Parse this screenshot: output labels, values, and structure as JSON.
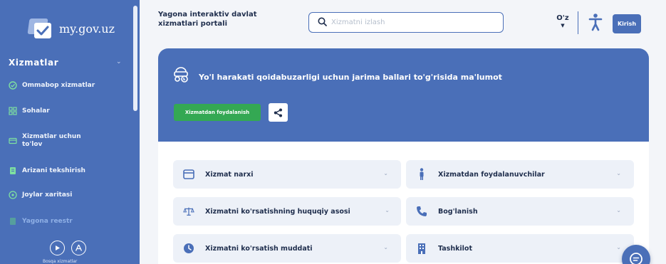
{
  "brand": {
    "logo_text": "my.gov.uz"
  },
  "sidebar": {
    "section_title": "Xizmatlar",
    "items": [
      {
        "label": "Ommabop xizmatlar",
        "icon": "check-circle-icon"
      },
      {
        "label": "Sohalar",
        "icon": "grid-icon"
      },
      {
        "label": "Xizmatlar uchun to'lov",
        "icon": "card-icon"
      },
      {
        "label": "Arizani tekshirish",
        "icon": "document-icon"
      },
      {
        "label": "Joylar xaritasi",
        "icon": "location-icon"
      },
      {
        "label": "Yagona reestr",
        "icon": "registry-icon"
      }
    ],
    "footer_text": "Bosqa xizmatlar"
  },
  "header": {
    "portal_title": "Yagona interaktiv davlat xizmatlari portali",
    "search_placeholder": "Xizmatni izlash",
    "language": "O'z",
    "login_label": "Kirish"
  },
  "banner": {
    "title": "Yo'l harakati qoidabuzarligi uchun jarima ballari to'g'risida ma'lumot",
    "use_button": "Xizmatdan foydalanish"
  },
  "cards": [
    {
      "label": "Xizmat narxi",
      "icon": "wallet-icon"
    },
    {
      "label": "Xizmatdan foydalanuvchilar",
      "icon": "person-icon"
    },
    {
      "label": "Xizmatni ko'rsatishning huquqiy asosi",
      "icon": "scales-icon"
    },
    {
      "label": "Bog'lanish",
      "icon": "phone-icon"
    },
    {
      "label": "Xizmatni ko'rsatish muddati",
      "icon": "clock-icon"
    },
    {
      "label": "Tashkilot",
      "icon": "building-icon"
    }
  ],
  "colors": {
    "primary": "#4a6fb8",
    "green": "#34a853",
    "card_bg": "#edf1f8",
    "text_dark": "#1f2e4d"
  }
}
